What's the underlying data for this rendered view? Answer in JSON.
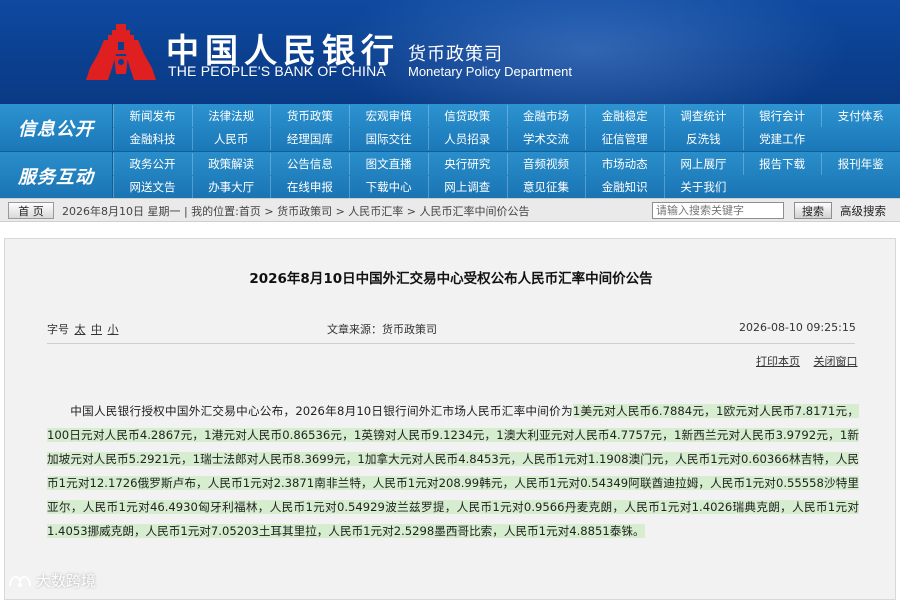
{
  "header": {
    "logo_cn": "中国人民银行",
    "logo_en": "THE PEOPLE'S BANK OF CHINA",
    "dept_cn": "货币政策司",
    "dept_en": "Monetary Policy Department"
  },
  "nav": {
    "section1_label": "信息公开",
    "section2_label": "服务互动",
    "row1a": [
      "新闻发布",
      "法律法规",
      "货币政策",
      "宏观审慎",
      "信贷政策",
      "金融市场",
      "金融稳定",
      "调查统计",
      "银行会计",
      "支付体系"
    ],
    "row1b": [
      "金融科技",
      "人民币",
      "经理国库",
      "国际交往",
      "人员招录",
      "学术交流",
      "征信管理",
      "反洗钱",
      "党建工作"
    ],
    "row2a": [
      "政务公开",
      "政策解读",
      "公告信息",
      "图文直播",
      "央行研究",
      "音频视频",
      "市场动态",
      "网上展厅",
      "报告下载",
      "报刊年鉴"
    ],
    "row2b": [
      "网送文告",
      "办事大厅",
      "在线申报",
      "下载中心",
      "网上调查",
      "意见征集",
      "金融知识",
      "关于我们"
    ]
  },
  "crumbbar": {
    "home_label": "首 页",
    "text": "2026年8月10日 星期一 | 我的位置:首页 > 货币政策司 > 人民币汇率 > 人民币汇率中间价公告",
    "search_placeholder": "请输入搜索关键字",
    "search_button": "搜索",
    "advanced_search": "高级搜索"
  },
  "article": {
    "title": "2026年8月10日中国外汇交易中心受权公布人民币汇率中间价公告",
    "font_size_label": "字号",
    "font_sizes": [
      "太",
      "中",
      "小"
    ],
    "source": "文章来源：货币政策司",
    "datetime": "2026-08-10 09:25:15",
    "print_label": "打印本页",
    "close_label": "关闭窗口",
    "body_intro": "中国人民银行授权中国外汇交易中心公布，2026年8月10日银行间外汇市场人民币汇率中间价为",
    "body_rates": "1美元对人民币6.7884元，1欧元对人民币7.8171元，100日元对人民币4.2867元，1港元对人民币0.86536元，1英镑对人民币9.1234元，1澳大利亚元对人民币4.7757元，1新西兰元对人民币3.9792元，1新加坡元对人民币5.2921元，1瑞士法郎对人民币8.3699元，1加拿大元对人民币4.8453元，人民币1元对1.1908澳门元，人民币1元对0.60366林吉特，人民币1元对12.1726俄罗斯卢布，人民币1元对2.3871南非兰特，人民币1元对208.99韩元，人民币1元对0.54349阿联酋迪拉姆，人民币1元对0.55558沙特里亚尔，人民币1元对46.4930匈牙利福林，人民币1元对0.54929波兰兹罗提，人民币1元对0.9566丹麦克朗，人民币1元对1.4026瑞典克朗，人民币1元对1.4053挪威克朗，人民币1元对7.05203土耳其里拉，人民币1元对2.5298墨西哥比索，人民币1元对4.8851泰铢。"
  },
  "watermark": "大数跨境",
  "colors": {
    "header_blue": "#0b3f8e",
    "nav_blue": "#1b78b8",
    "highlight": "#d6edcf",
    "emblem_red": "#e02020"
  }
}
